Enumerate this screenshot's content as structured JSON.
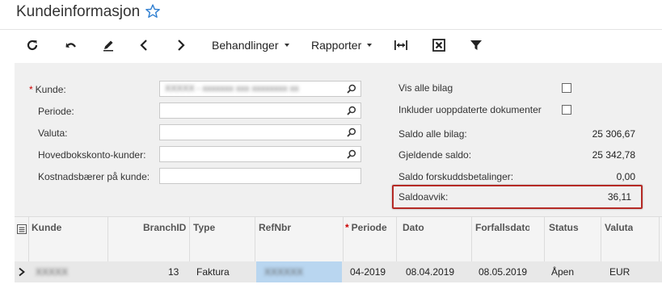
{
  "header": {
    "title": "Kundeinformasjon"
  },
  "toolbar": {
    "icons": [
      "refresh-icon",
      "undo-icon",
      "edit-icon",
      "previous-icon",
      "next-icon",
      "fit-columns-icon",
      "excel-export-icon",
      "filter-icon"
    ],
    "behandlinger_label": "Behandlinger",
    "rapporter_label": "Rapporter"
  },
  "form": {
    "kunde": {
      "label": "Kunde:",
      "required_mark": "*",
      "value": "XXXXX - xxxxxxx xxx xxxxxxxx xx"
    },
    "periode": {
      "label": "Periode:",
      "value": ""
    },
    "valuta": {
      "label": "Valuta:",
      "value": ""
    },
    "hovedbokskonto": {
      "label": "Hovedbokskonto-kunder:",
      "value": ""
    },
    "kostnadsbaerer": {
      "label": "Kostnadsbærer på kunde:",
      "value": ""
    },
    "vis_alle_bilag": {
      "label": "Vis alle bilag",
      "checked": false
    },
    "inkluder": {
      "label": "Inkluder uoppdaterte dokumenter",
      "checked": false
    },
    "saldo_alle_bilag": {
      "label": "Saldo alle bilag:",
      "value": "25 306,67"
    },
    "gjeldende_saldo": {
      "label": "Gjeldende saldo:",
      "value": "25 342,78"
    },
    "saldo_forskudd": {
      "label": "Saldo forskuddsbetalinger:",
      "value": "0,00"
    },
    "saldoavvik": {
      "label": "Saldoavvik:",
      "value": "36,11"
    },
    "highlight_color": "#b52a25"
  },
  "grid": {
    "columns": {
      "kunde": "Kunde",
      "branchid": "BranchID",
      "type": "Type",
      "refnbr": "RefNbr",
      "periode": "Periode",
      "periode_required": "*",
      "dato": "Dato",
      "forfallsdato": "Forfallsdato",
      "status": "Status",
      "valuta": "Valuta"
    },
    "rows": [
      {
        "kunde": "XXXXX",
        "branchid": "13",
        "type": "Faktura",
        "refnbr": "XXXXXX",
        "periode": "04-2019",
        "dato": "08.04.2019",
        "forfallsdato": "08.05.2019",
        "status": "Åpen",
        "valuta": "EUR"
      }
    ]
  }
}
